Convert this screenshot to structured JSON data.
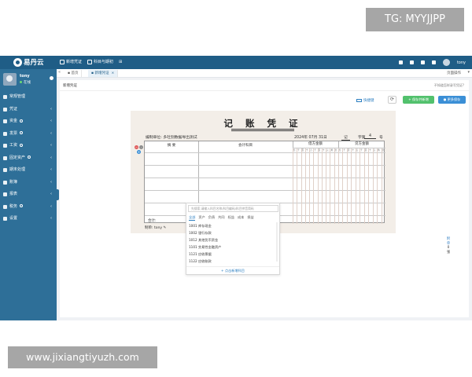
{
  "watermark_top": "TG: MYYJJPP",
  "watermark_bottom": "www.jixiangtiyuzh.com",
  "app": {
    "brand": "易丹云",
    "top_nav": [
      "新增凭证",
      "科目与期初"
    ],
    "user_top": "tony"
  },
  "sidebar": {
    "user": {
      "name": "tony",
      "status": "在线"
    },
    "items": [
      {
        "label": "常规管理"
      },
      {
        "label": "凭证"
      },
      {
        "label": "资金"
      },
      {
        "label": "发票"
      },
      {
        "label": "工资"
      },
      {
        "label": "固定资产"
      },
      {
        "label": "期末处理"
      },
      {
        "label": "账簿"
      },
      {
        "label": "报表"
      },
      {
        "label": "税务"
      },
      {
        "label": "设置"
      }
    ]
  },
  "tabs": {
    "home": "首页",
    "active": "新增凭证",
    "ops": "页面操作"
  },
  "page": {
    "crumb": "新增凭证",
    "help": "不知道怎样录写凭证?",
    "quick_btn": "快捷键",
    "save_new_btn": "保存并新增",
    "more_btn": "更多保存"
  },
  "voucher": {
    "title": "记 账 凭 证",
    "unit_label": "编制单位:",
    "unit_name": "多社别数据导出测试",
    "date": "2024年 07月 31日",
    "type": "记",
    "no_label": "字第",
    "no": "4",
    "hao": "号",
    "col_summary": "摘 要",
    "col_subject": "会计科目",
    "col_debit": "借方金额",
    "col_credit": "贷方金额",
    "digit_labels": [
      "亿",
      "千",
      "百",
      "十",
      "万",
      "千",
      "百",
      "十",
      "元",
      "角",
      "分"
    ],
    "sum_label": "合计:",
    "maker_label": "制单:",
    "maker": "tony",
    "attach_label": "附",
    "attach_unit": "单",
    "attach_count": "0",
    "attach_tail": "张"
  },
  "dropdown": {
    "search_placeholder": "先搜索,请输入科目名称/科目编码/科目拼音简码",
    "tabs": [
      "全部",
      "资产",
      "负债",
      "共同",
      "权益",
      "成本",
      "损益"
    ],
    "items": [
      {
        "code": "1001",
        "name": "库存现金"
      },
      {
        "code": "1002",
        "name": "银行存款"
      },
      {
        "code": "1012",
        "name": "其他货币资金"
      },
      {
        "code": "1101",
        "name": "交易性金融资产"
      },
      {
        "code": "1121",
        "name": "应收票据"
      },
      {
        "code": "1122",
        "name": "应收账款"
      }
    ],
    "footer": "+ 点击新增科目"
  }
}
